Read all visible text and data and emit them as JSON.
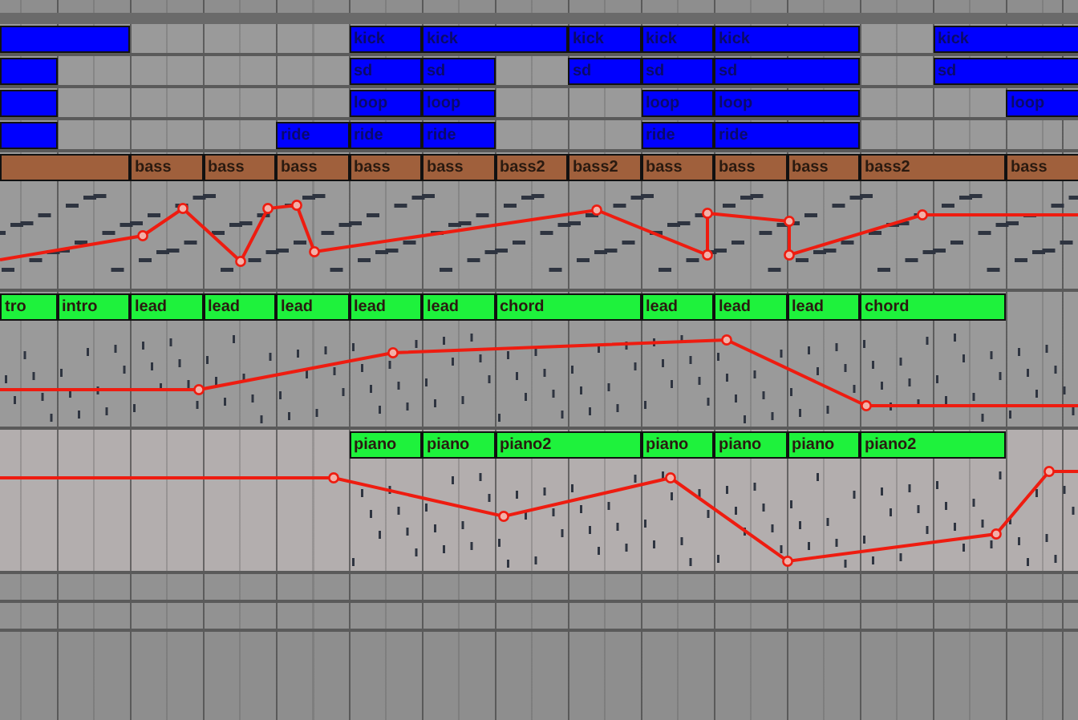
{
  "tracks": [
    {
      "color": "#0000ff",
      "expanded": false,
      "clips": [
        {
          "kind": "clip",
          "long": true
        },
        {
          "kind": "gap"
        },
        {
          "kind": "gap"
        },
        {
          "kind": "gap"
        },
        {
          "kind": "clip",
          "label": "kick",
          "long": false
        },
        {
          "kind": "clip",
          "label": "kick",
          "long": true
        },
        {
          "kind": "clip",
          "label": "kick",
          "long": false
        },
        {
          "kind": "clip",
          "label": "kick",
          "long": false
        },
        {
          "kind": "clip",
          "label": "kick",
          "long": true
        },
        {
          "kind": "gap"
        },
        {
          "kind": "clip",
          "label": "kick",
          "long": true
        }
      ]
    },
    {
      "color": "#0000ff",
      "expanded": false,
      "clips": [
        {
          "kind": "clip",
          "long": false
        },
        {
          "kind": "gap"
        },
        {
          "kind": "gap"
        },
        {
          "kind": "gap"
        },
        {
          "kind": "gap"
        },
        {
          "kind": "clip",
          "label": "sd",
          "long": false
        },
        {
          "kind": "clip",
          "label": "sd",
          "long": false
        },
        {
          "kind": "gap"
        },
        {
          "kind": "clip",
          "label": "sd",
          "long": false
        },
        {
          "kind": "clip",
          "label": "sd",
          "long": false
        },
        {
          "kind": "clip",
          "label": "sd",
          "long": true
        },
        {
          "kind": "gap"
        },
        {
          "kind": "clip",
          "label": "sd",
          "long": true
        }
      ]
    },
    {
      "color": "#0000ff",
      "expanded": false,
      "clips": [
        {
          "kind": "clip",
          "long": false
        },
        {
          "kind": "gap"
        },
        {
          "kind": "gap"
        },
        {
          "kind": "gap"
        },
        {
          "kind": "gap"
        },
        {
          "kind": "clip",
          "label": "loop",
          "long": false
        },
        {
          "kind": "clip",
          "label": "loop",
          "long": false
        },
        {
          "kind": "gap"
        },
        {
          "kind": "gap"
        },
        {
          "kind": "clip",
          "label": "loop",
          "long": false
        },
        {
          "kind": "clip",
          "label": "loop",
          "long": true
        },
        {
          "kind": "gap"
        },
        {
          "kind": "gap"
        },
        {
          "kind": "clip",
          "label": "loop",
          "long": false
        }
      ]
    },
    {
      "color": "#0000ff",
      "expanded": false,
      "clips": [
        {
          "kind": "clip",
          "long": false
        },
        {
          "kind": "gap"
        },
        {
          "kind": "gap"
        },
        {
          "kind": "gap"
        },
        {
          "kind": "clip",
          "label": "ride",
          "long": false
        },
        {
          "kind": "clip",
          "label": "ride",
          "long": false
        },
        {
          "kind": "clip",
          "label": "ride",
          "long": false
        },
        {
          "kind": "gap"
        },
        {
          "kind": "gap"
        },
        {
          "kind": "clip",
          "label": "ride",
          "long": false
        },
        {
          "kind": "clip",
          "label": "ride",
          "long": true
        }
      ]
    },
    {
      "color": "#a0603c",
      "expanded": true,
      "clips": [
        {
          "kind": "clip",
          "long": true
        },
        {
          "kind": "clip",
          "label": "bass",
          "long": false
        },
        {
          "kind": "clip",
          "label": "bass",
          "long": false
        },
        {
          "kind": "clip",
          "label": "bass",
          "long": false
        },
        {
          "kind": "clip",
          "label": "bass",
          "long": false
        },
        {
          "kind": "clip",
          "label": "bass",
          "long": false
        },
        {
          "kind": "clip",
          "label": "bass2",
          "long": false
        },
        {
          "kind": "clip",
          "label": "bass2",
          "long": false
        },
        {
          "kind": "clip",
          "label": "bass",
          "long": false
        },
        {
          "kind": "clip",
          "label": "bass",
          "long": false
        },
        {
          "kind": "clip",
          "label": "bass",
          "long": false
        },
        {
          "kind": "clip",
          "label": "bass2",
          "long": true
        },
        {
          "kind": "clip",
          "label": "bass",
          "long": false
        }
      ]
    },
    {
      "color": "#1ef23c",
      "expanded": true,
      "clips": [
        {
          "kind": "clip",
          "label": "tro",
          "long": false
        },
        {
          "kind": "clip",
          "label": "intro",
          "long": false
        },
        {
          "kind": "clip",
          "label": "lead",
          "long": false
        },
        {
          "kind": "clip",
          "label": "lead",
          "long": false
        },
        {
          "kind": "clip",
          "label": "lead",
          "long": false
        },
        {
          "kind": "clip",
          "label": "lead",
          "long": false
        },
        {
          "kind": "clip",
          "label": "lead",
          "long": false
        },
        {
          "kind": "clip",
          "label": "chord",
          "long": true
        },
        {
          "kind": "clip",
          "label": "lead",
          "long": false
        },
        {
          "kind": "clip",
          "label": "lead",
          "long": false
        },
        {
          "kind": "clip",
          "label": "lead",
          "long": false
        },
        {
          "kind": "clip",
          "label": "chord",
          "long": true
        }
      ]
    },
    {
      "color": "#1ef23c",
      "expanded": true,
      "clips": [
        {
          "kind": "gap"
        },
        {
          "kind": "gap"
        },
        {
          "kind": "gap"
        },
        {
          "kind": "gap"
        },
        {
          "kind": "gap"
        },
        {
          "kind": "clip",
          "label": "piano",
          "long": false
        },
        {
          "kind": "clip",
          "label": "piano",
          "long": false
        },
        {
          "kind": "clip",
          "label": "piano2",
          "long": true
        },
        {
          "kind": "clip",
          "label": "piano",
          "long": false
        },
        {
          "kind": "clip",
          "label": "piano",
          "long": false
        },
        {
          "kind": "clip",
          "label": "piano",
          "long": false
        },
        {
          "kind": "clip",
          "label": "piano2",
          "long": true
        }
      ]
    }
  ]
}
